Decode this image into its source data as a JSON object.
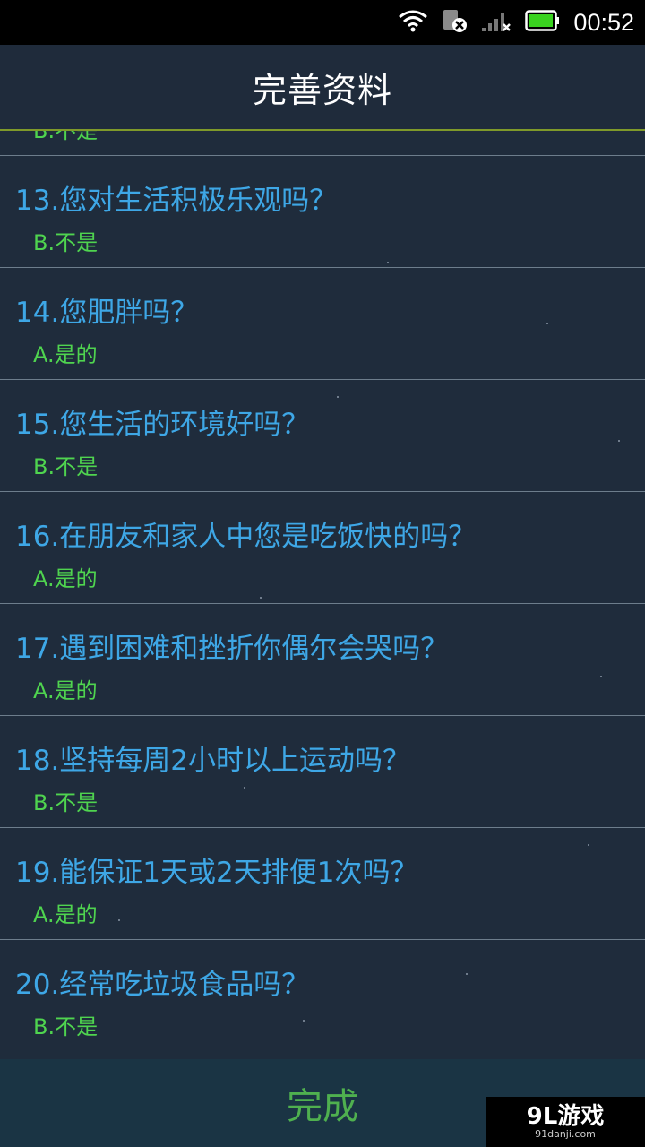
{
  "status_bar": {
    "time": "00:52",
    "icons": [
      "wifi-icon",
      "sim-disabled-icon",
      "signal-icon",
      "battery-icon"
    ],
    "battery_color": "#39d21f"
  },
  "header": {
    "title": "完善资料"
  },
  "questions": [
    {
      "question": "",
      "answer": "B.不是"
    },
    {
      "question": "13.您对生活积极乐观吗？",
      "answer": "B.不是"
    },
    {
      "question": "14.您肥胖吗？",
      "answer": "A.是的"
    },
    {
      "question": "15.您生活的环境好吗？",
      "answer": "B.不是"
    },
    {
      "question": "16.在朋友和家人中您是吃饭快的吗？",
      "answer": "A.是的"
    },
    {
      "question": "17.遇到困难和挫折你偶尔会哭吗？",
      "answer": "A.是的"
    },
    {
      "question": "18.坚持每周2小时以上运动吗？",
      "answer": "B.不是"
    },
    {
      "question": "19.能保证1天或2天排便1次吗？",
      "answer": "A.是的"
    },
    {
      "question": "20.经常吃垃圾食品吗？",
      "answer": "B.不是"
    }
  ],
  "footer": {
    "done_label": "完成"
  },
  "watermark": {
    "main": "9L游戏",
    "sub": "91danji.com"
  },
  "colors": {
    "question": "#3ea7e6",
    "answer": "#4fd44f",
    "done": "#4fb04f",
    "header_line": "#7f9a2a"
  }
}
